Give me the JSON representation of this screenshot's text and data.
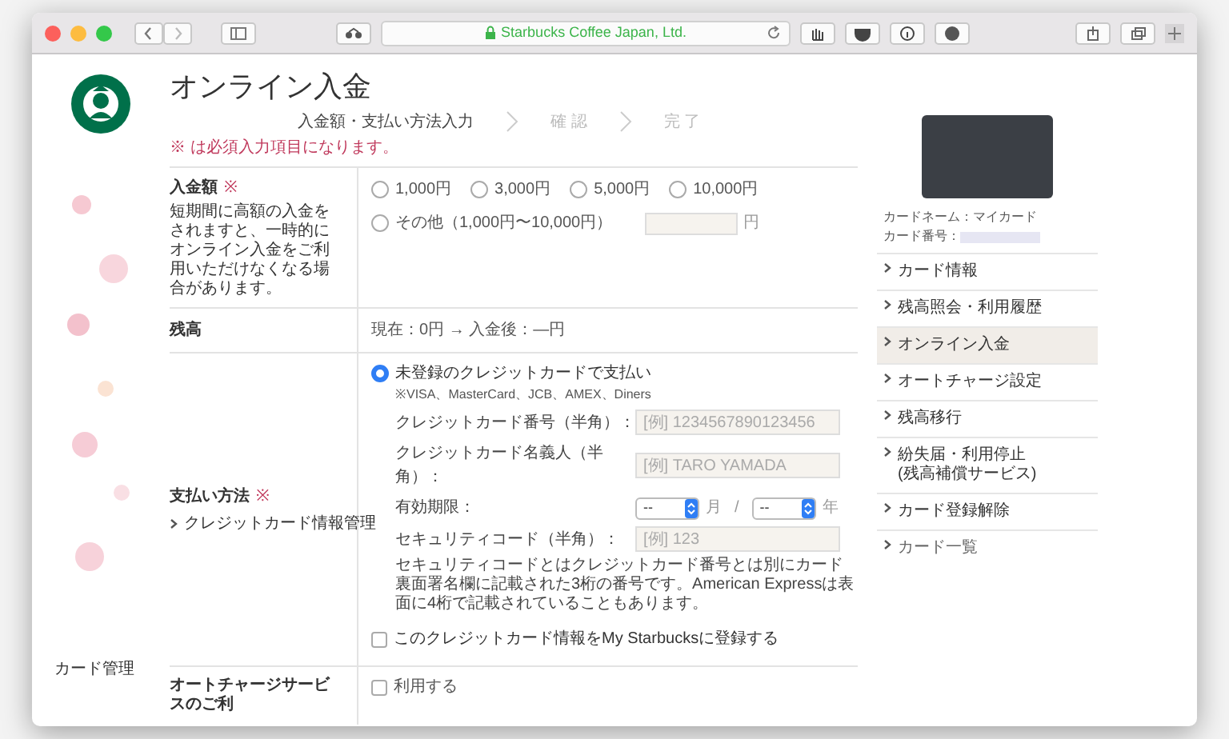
{
  "browser": {
    "address": "Starbucks Coffee Japan, Ltd."
  },
  "page": {
    "title": "オンライン入金",
    "side_label": "カード管理"
  },
  "steps": [
    {
      "label": "入金額・支払い方法入力",
      "selected": true
    },
    {
      "label": "確 認",
      "selected": false
    },
    {
      "label": "完 了",
      "selected": false
    }
  ],
  "required_note": "※ は必須入力項目になります。",
  "amount": {
    "label": "入金額",
    "required_mark": "※",
    "note": "短期間に高額の入金をされますと、一時的にオンライン入金をご利用いただけなくなる場合があります。",
    "options": [
      {
        "label": "1,000円",
        "selected": false
      },
      {
        "label": "3,000円",
        "selected": false
      },
      {
        "label": "5,000円",
        "selected": false
      },
      {
        "label": "10,000円",
        "selected": false
      }
    ],
    "other": {
      "label": "その他（1,000円〜10,000円）",
      "selected": false,
      "unit": "円"
    }
  },
  "balance": {
    "label": "残高",
    "value": "現在：0円 → 入金後：―円"
  },
  "payment": {
    "label": "支払い方法",
    "required_mark": "※",
    "link": "クレジットカード情報管理",
    "method": {
      "label": "未登録のクレジットカードで支払い",
      "selected": true,
      "note": "※VISA、MasterCard、JCB、AMEX、Diners"
    },
    "fields": [
      {
        "kind": "text",
        "label": "クレジットカード番号（半角）：",
        "placeholder": "[例] 1234567890123456"
      },
      {
        "kind": "text",
        "label": "クレジットカード名義人（半角）：",
        "placeholder": "[例] TARO YAMADA"
      },
      {
        "kind": "expiry",
        "label": "有効期限：",
        "month": "--",
        "month_unit": "月",
        "separator": "/",
        "year": "--",
        "year_unit": "年"
      },
      {
        "kind": "text",
        "label": "セキュリティコード（半角）：",
        "placeholder": "[例] 123"
      }
    ],
    "security_note": "セキュリティコードとはクレジットカード番号とは別にカード裏面署名欄に記載された3桁の番号です。American Expressは表面に4桁で記載されていることもあります。",
    "save": {
      "label": "このクレジットカード情報をMy Starbucksに登録する",
      "checked": false
    }
  },
  "auto_charge": {
    "label": "オートチャージサービスのご利",
    "option": {
      "label": "利用する",
      "checked": false
    }
  },
  "card": {
    "name": "カードネーム：マイカード",
    "number_label": "カード番号："
  },
  "menu": [
    {
      "label": "カード情報",
      "selected": false,
      "kind": "normal"
    },
    {
      "label": "残高照会・利用履歴",
      "selected": false,
      "kind": "normal"
    },
    {
      "label": "オンライン入金",
      "selected": true,
      "kind": "normal"
    },
    {
      "label": "オートチャージ設定",
      "selected": false,
      "kind": "normal"
    },
    {
      "label": "残高移行",
      "selected": false,
      "kind": "normal"
    },
    {
      "label": "紛失届・利用停止\n(残高補償サービス)",
      "selected": false,
      "kind": "normal"
    },
    {
      "label": "カード登録解除",
      "selected": false,
      "kind": "normal"
    },
    {
      "label": "カード一覧",
      "selected": false,
      "kind": "small"
    }
  ]
}
